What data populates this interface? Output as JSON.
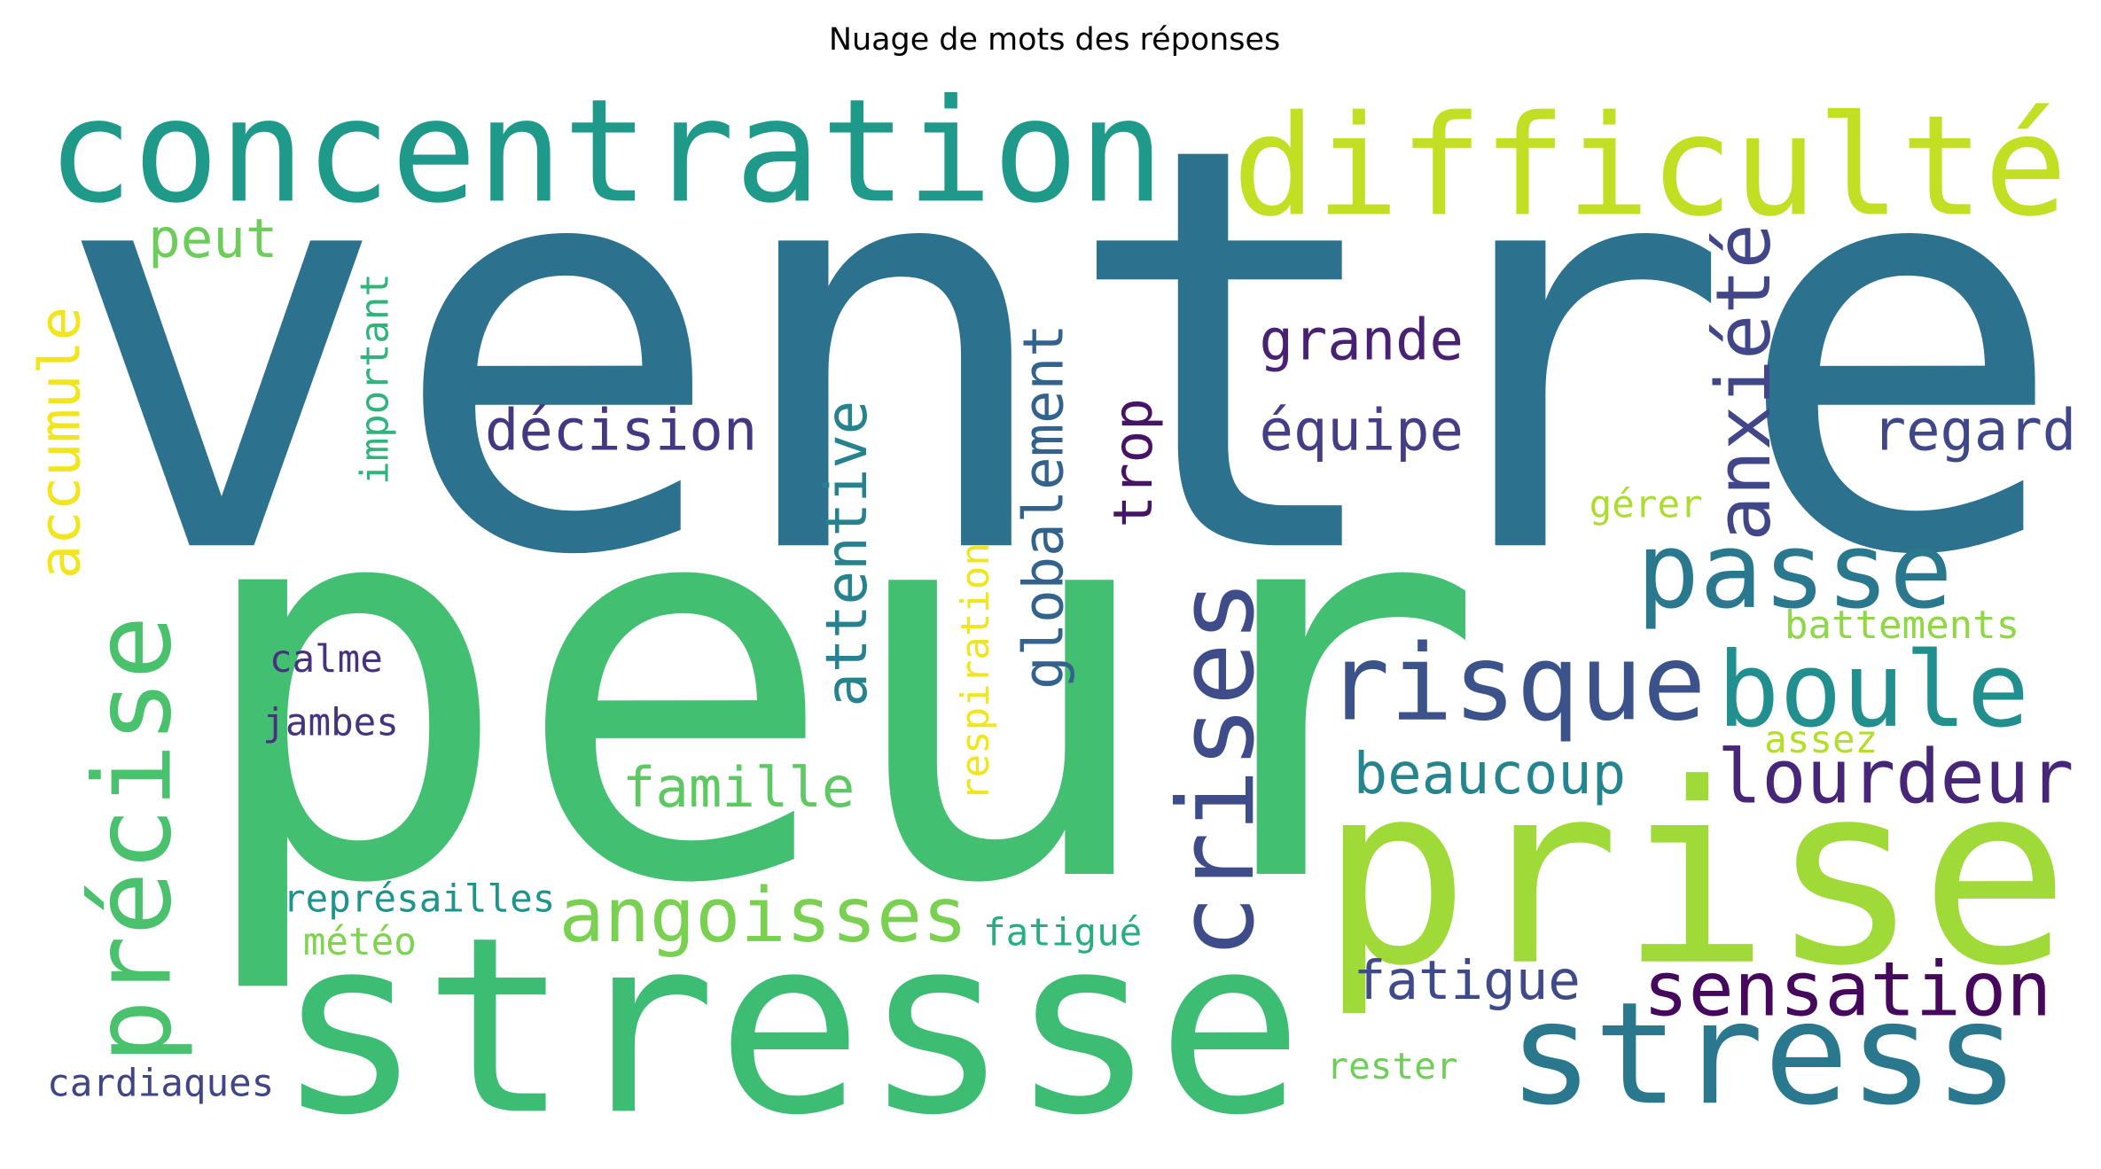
{
  "title": "Nuage de mots des réponses",
  "words": {
    "ventre": {
      "text": "ventre",
      "color": "#2c728e"
    },
    "peur": {
      "text": "peur",
      "color": "#43bf71"
    },
    "concentration": {
      "text": "concentration",
      "color": "#1f9a8a"
    },
    "difficulte": {
      "text": "difficulté",
      "color": "#c2df23"
    },
    "prise": {
      "text": "prise",
      "color": "#a0da39"
    },
    "stresse": {
      "text": "stresse",
      "color": "#3dbc74"
    },
    "stress": {
      "text": "stress",
      "color": "#2a788e"
    },
    "risque": {
      "text": "risque",
      "color": "#3b528b"
    },
    "boule": {
      "text": "boule",
      "color": "#218f8d"
    },
    "passe": {
      "text": "passe",
      "color": "#2a788e"
    },
    "lourdeur": {
      "text": "lourdeur",
      "color": "#482677"
    },
    "sensation": {
      "text": "sensation",
      "color": "#46085c"
    },
    "fatigue": {
      "text": "fatigue",
      "color": "#3e4a89"
    },
    "beaucoup": {
      "text": "beaucoup",
      "color": "#25858e"
    },
    "angoisses": {
      "text": "angoisses",
      "color": "#7ad151"
    },
    "famille": {
      "text": "famille",
      "color": "#5ec962"
    },
    "decision": {
      "text": "décision",
      "color": "#453781"
    },
    "grande": {
      "text": "grande",
      "color": "#482173"
    },
    "equipe": {
      "text": "équipe",
      "color": "#433e85"
    },
    "regard": {
      "text": "regard",
      "color": "#3f4788"
    },
    "peut": {
      "text": "peut",
      "color": "#6ccd5a"
    },
    "gerer": {
      "text": "gérer",
      "color": "#addc30"
    },
    "battements": {
      "text": "battements",
      "color": "#8fd744"
    },
    "assez": {
      "text": "assez",
      "color": "#b5de2b"
    },
    "calme": {
      "text": "calme",
      "color": "#46327e"
    },
    "jambes": {
      "text": "jambes",
      "color": "#46337e"
    },
    "representailles": {
      "text": "représailles",
      "color": "#1f948c"
    },
    "meteo": {
      "text": "météo",
      "color": "#7fd34e"
    },
    "fatigue2": {
      "text": "fatigué",
      "color": "#27ad81"
    },
    "cardiaques": {
      "text": "cardiaques",
      "color": "#414487"
    },
    "rester": {
      "text": "rester",
      "color": "#6ece58"
    },
    "accumule": {
      "text": "accumule",
      "color": "#f2e51d"
    },
    "precise": {
      "text": "précise",
      "color": "#4ac16d"
    },
    "important": {
      "text": "important",
      "color": "#2fb47c"
    },
    "attentive": {
      "text": "attentive",
      "color": "#26828e"
    },
    "respiration": {
      "text": "respiration",
      "color": "#f1e51d"
    },
    "globalement": {
      "text": "globalement",
      "color": "#33638d"
    },
    "trop": {
      "text": "trop",
      "color": "#471365"
    },
    "crises": {
      "text": "crises",
      "color": "#3e4c8a"
    },
    "anxiete": {
      "text": "anxiété",
      "color": "#404688"
    }
  }
}
